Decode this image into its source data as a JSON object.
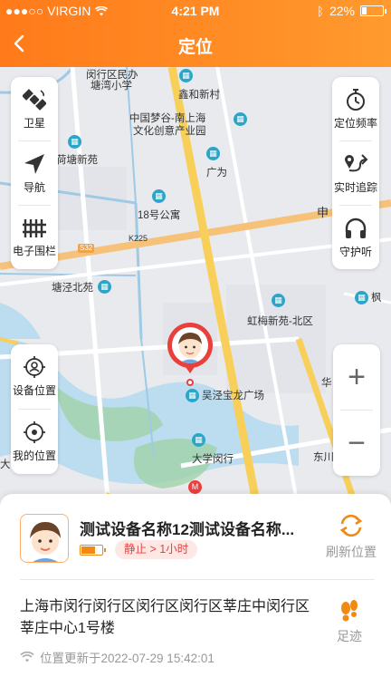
{
  "status_bar": {
    "carrier": "●●●○○ VIRGIN",
    "time": "4:21 PM",
    "battery": "22%"
  },
  "header": {
    "title": "定位",
    "back_icon": "chevron-left-icon"
  },
  "colors": {
    "accent": "#ff7f1f",
    "marker": "#e8413c",
    "poi": "#2ba5c8",
    "road_major": "#f7cf59",
    "road_orange": "#f6c27a",
    "water": "#bcdcef"
  },
  "map": {
    "labels": {
      "minhang_district": "闵行区民办",
      "tangwan_school": "塘湾小学",
      "xinhe_village": "鑫和新村",
      "mengyue": "中国梦谷-南上海",
      "creative_park": "文化创意产业园",
      "hetang": "荷塘新苑",
      "guangwei": "广为",
      "apartment_18": "18号公寓",
      "shen": "申",
      "k225": "K225",
      "s32": "S32",
      "tangjing_north": "塘泾北苑",
      "hongmei": "虹梅新苑-北区",
      "feng": "枫",
      "wujing_plaza": "吴泾宝龙广场",
      "hua": "华",
      "university": "大学闵行",
      "dong": "东川",
      "da": "大"
    }
  },
  "left_tools": [
    {
      "label": "卫星",
      "icon": "satellite-icon"
    },
    {
      "label": "导航",
      "icon": "navigation-icon"
    },
    {
      "label": "电子围栏",
      "icon": "fence-icon"
    }
  ],
  "right_tools": [
    {
      "label": "定位频率",
      "icon": "stopwatch-icon"
    },
    {
      "label": "实时追踪",
      "icon": "route-icon"
    },
    {
      "label": "守护听",
      "icon": "headphones-icon"
    }
  ],
  "location_tools": [
    {
      "label": "设备位置",
      "icon": "device-location-icon"
    },
    {
      "label": "我的位置",
      "icon": "my-location-icon"
    }
  ],
  "zoom": {
    "in": "+",
    "out": "−"
  },
  "device": {
    "name": "测试设备名称12测试设备名称...",
    "battery_level": 0.7,
    "status": "静止 > 1小时",
    "refresh_label": "刷新位置",
    "address": "上海市闵行闵行区闵行区闵行区莘庄中闵行区莘庄中心1号楼",
    "updated": "位置更新于2022-07-29 15:42:01",
    "track_label": "足迹"
  }
}
